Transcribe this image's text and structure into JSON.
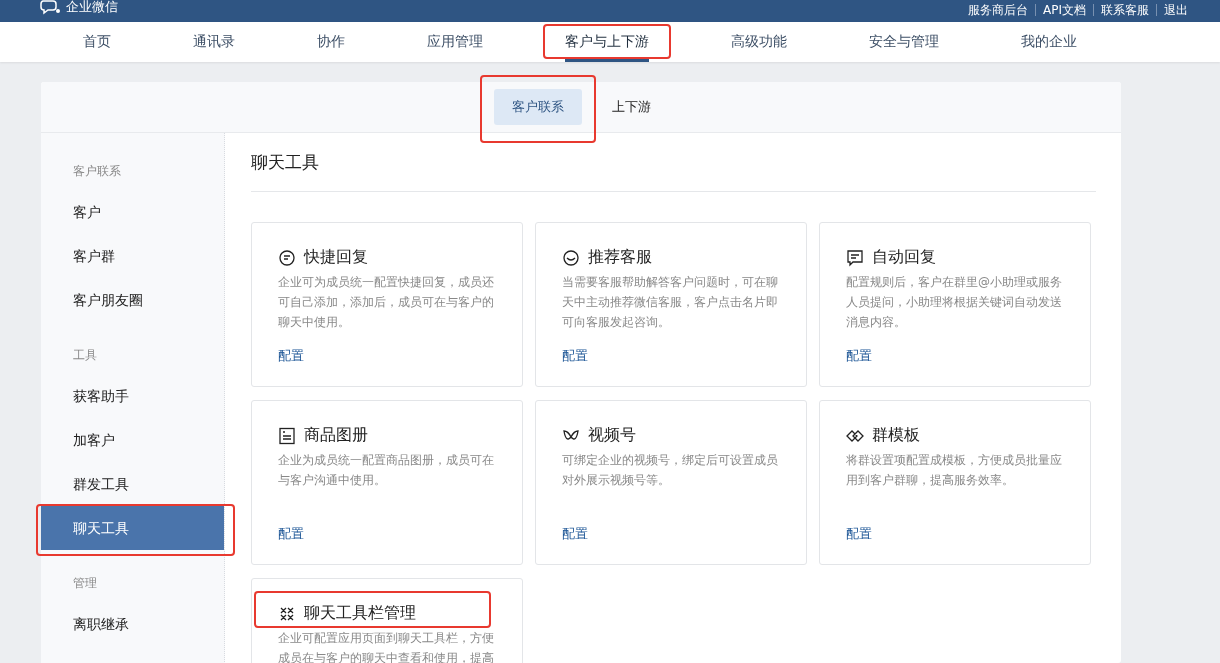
{
  "topbar": {
    "logo": "企业微信",
    "links": [
      "服务商后台",
      "API文档",
      "联系客服",
      "退出"
    ]
  },
  "nav": [
    {
      "label": "首页",
      "selected": false,
      "highlighted": false
    },
    {
      "label": "通讯录",
      "selected": false,
      "highlighted": false
    },
    {
      "label": "协作",
      "selected": false,
      "highlighted": false
    },
    {
      "label": "应用管理",
      "selected": false,
      "highlighted": false
    },
    {
      "label": "客户与上下游",
      "selected": true,
      "highlighted": true
    },
    {
      "label": "高级功能",
      "selected": false,
      "highlighted": false
    },
    {
      "label": "安全与管理",
      "selected": false,
      "highlighted": false
    },
    {
      "label": "我的企业",
      "selected": false,
      "highlighted": false
    }
  ],
  "subtabs": [
    {
      "label": "客户联系",
      "selected": true,
      "highlighted": true
    },
    {
      "label": "上下游",
      "selected": false,
      "highlighted": false
    }
  ],
  "sidebar": [
    {
      "title": "客户联系",
      "items": [
        {
          "label": "客户",
          "selected": false,
          "highlighted": false
        },
        {
          "label": "客户群",
          "selected": false,
          "highlighted": false
        },
        {
          "label": "客户朋友圈",
          "selected": false,
          "highlighted": false
        }
      ]
    },
    {
      "title": "工具",
      "items": [
        {
          "label": "获客助手",
          "selected": false,
          "highlighted": false
        },
        {
          "label": "加客户",
          "selected": false,
          "highlighted": false
        },
        {
          "label": "群发工具",
          "selected": false,
          "highlighted": false
        },
        {
          "label": "聊天工具",
          "selected": true,
          "highlighted": true
        }
      ]
    },
    {
      "title": "管理",
      "items": [
        {
          "label": "离职继承",
          "selected": false,
          "highlighted": false
        }
      ]
    }
  ],
  "content": {
    "title": "聊天工具",
    "tools": [
      {
        "kind": "quick-reply",
        "title": "快捷回复",
        "description": "企业可为成员统一配置快捷回复，成员还可自己添加，添加后，成员可在与客户的聊天中使用。",
        "action": "配置",
        "highlighted": false
      },
      {
        "kind": "service",
        "title": "推荐客服",
        "description": "当需要客服帮助解答客户问题时，可在聊天中主动推荐微信客服，客户点击名片即可向客服发起咨询。",
        "action": "配置",
        "highlighted": false
      },
      {
        "kind": "auto-reply",
        "title": "自动回复",
        "description": "配置规则后，客户在群里@小助理或服务人员提问，小助理将根据关键词自动发送消息内容。",
        "action": "配置",
        "highlighted": false
      },
      {
        "kind": "catalog",
        "title": "商品图册",
        "description": "企业为成员统一配置商品图册，成员可在与客户沟通中使用。",
        "action": "配置",
        "highlighted": false
      },
      {
        "kind": "channels",
        "title": "视频号",
        "description": "可绑定企业的视频号，绑定后可设置成员对外展示视频号等。",
        "action": "配置",
        "highlighted": false
      },
      {
        "kind": "template",
        "title": "群模板",
        "description": "将群设置项配置成模板，方便成员批量应用到客户群聊，提高服务效率。",
        "action": "配置",
        "highlighted": false
      },
      {
        "kind": "toolbar",
        "title": "聊天工具栏管理",
        "description": "企业可配置应用页面到聊天工具栏，方便成员在与客户的聊天中查看和使用，提高",
        "highlighted": true
      }
    ]
  }
}
